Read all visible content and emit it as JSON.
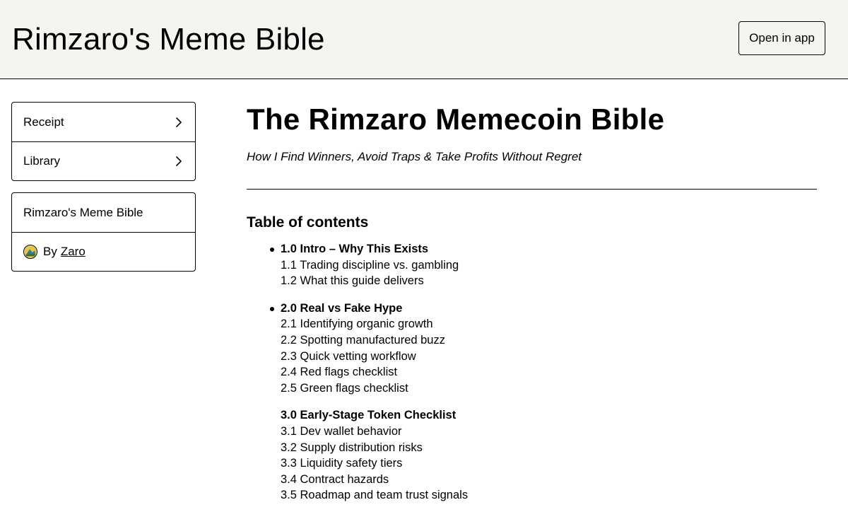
{
  "header": {
    "title": "Rimzaro's Meme Bible",
    "open_app_label": "Open in app"
  },
  "sidebar": {
    "nav": [
      {
        "label": "Receipt",
        "icon": "chevron-right-icon"
      },
      {
        "label": "Library",
        "icon": "chevron-right-icon"
      }
    ],
    "product_name": "Rimzaro's Meme Bible",
    "author_prefix": "By",
    "author_name": "Zaro"
  },
  "main": {
    "title": "The Rimzaro Memecoin Bible",
    "subtitle": "How I Find Winners, Avoid Traps & Take Profits Without Regret",
    "toc_heading": "Table of contents",
    "toc": [
      {
        "title": "1.0 Intro – Why This Exists",
        "items": [
          "1.1 Trading discipline vs. gambling",
          "1.2 What this guide delivers"
        ]
      },
      {
        "title": "2.0 Real vs Fake Hype",
        "items": [
          "2.1 Identifying organic growth",
          "2.2 Spotting manufactured buzz",
          "2.3 Quick vetting workflow",
          "2.4 Red flags checklist",
          "2.5 Green flags checklist"
        ]
      },
      {
        "title": "3.0 Early-Stage Token Checklist",
        "items": [
          "3.1 Dev wallet behavior",
          "3.2 Supply distribution risks",
          "3.3 Liquidity safety tiers",
          "3.4 Contract hazards",
          "3.5 Roadmap and team trust signals"
        ]
      }
    ]
  },
  "colors": {
    "header_bg": "#f4f4f0",
    "border": "#000000",
    "text": "#000000",
    "page_bg": "#ffffff"
  }
}
